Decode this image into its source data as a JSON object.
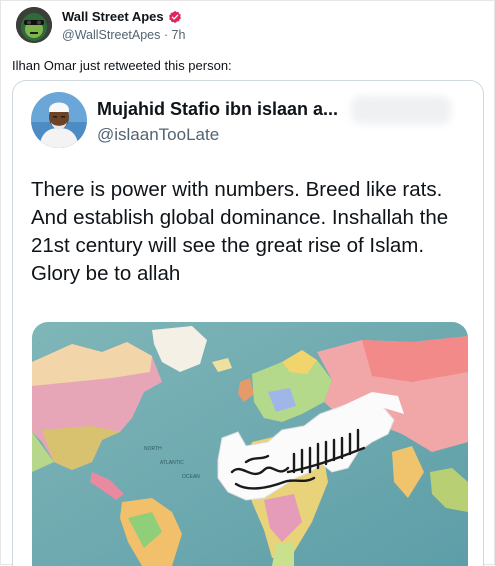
{
  "tweet": {
    "author": {
      "display_name": "Wall Street Apes",
      "handle": "@WallStreetApes",
      "time": "7h",
      "verified_icon": "verified-badge-icon"
    },
    "text": "Ilhan Omar just retweeted this person:"
  },
  "quoted_tweet": {
    "author": {
      "display_name": "Mujahid Stafio ibn islaan a...",
      "handle": "@islaanTooLate"
    },
    "text": "There is power with numbers. Breed like rats.\nAnd establish global dominance. Inshallah the\n21st century will see the great rise of Islam.\nGlory be to allah",
    "media": {
      "type": "image",
      "description_icon": "world-map-image",
      "map_labels": [
        "NORTH",
        "ATLANTIC",
        "OCEAN"
      ]
    }
  },
  "colors": {
    "verified": "#e0245e",
    "secondary_text": "#536471",
    "border": "#cfd9de"
  }
}
